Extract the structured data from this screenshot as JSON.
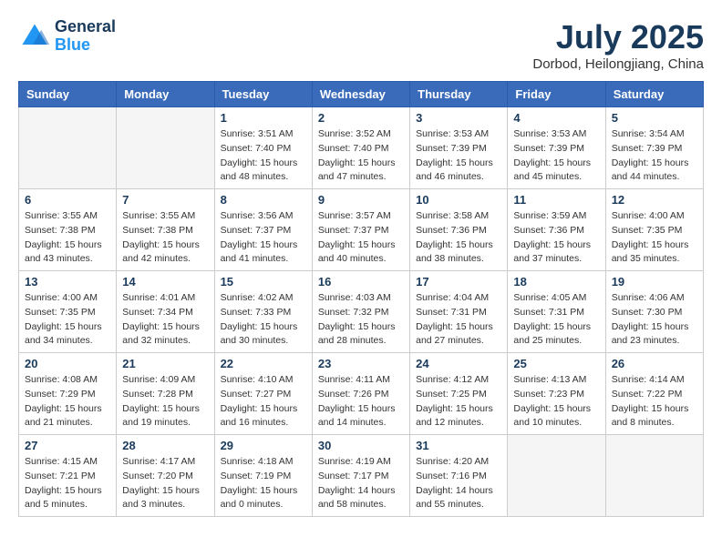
{
  "header": {
    "logo_line1": "General",
    "logo_line2": "Blue",
    "month_title": "July 2025",
    "location": "Dorbod, Heilongjiang, China"
  },
  "weekdays": [
    "Sunday",
    "Monday",
    "Tuesday",
    "Wednesday",
    "Thursday",
    "Friday",
    "Saturday"
  ],
  "weeks": [
    [
      {
        "day": "",
        "info": ""
      },
      {
        "day": "",
        "info": ""
      },
      {
        "day": "1",
        "info": "Sunrise: 3:51 AM\nSunset: 7:40 PM\nDaylight: 15 hours\nand 48 minutes."
      },
      {
        "day": "2",
        "info": "Sunrise: 3:52 AM\nSunset: 7:40 PM\nDaylight: 15 hours\nand 47 minutes."
      },
      {
        "day": "3",
        "info": "Sunrise: 3:53 AM\nSunset: 7:39 PM\nDaylight: 15 hours\nand 46 minutes."
      },
      {
        "day": "4",
        "info": "Sunrise: 3:53 AM\nSunset: 7:39 PM\nDaylight: 15 hours\nand 45 minutes."
      },
      {
        "day": "5",
        "info": "Sunrise: 3:54 AM\nSunset: 7:39 PM\nDaylight: 15 hours\nand 44 minutes."
      }
    ],
    [
      {
        "day": "6",
        "info": "Sunrise: 3:55 AM\nSunset: 7:38 PM\nDaylight: 15 hours\nand 43 minutes."
      },
      {
        "day": "7",
        "info": "Sunrise: 3:55 AM\nSunset: 7:38 PM\nDaylight: 15 hours\nand 42 minutes."
      },
      {
        "day": "8",
        "info": "Sunrise: 3:56 AM\nSunset: 7:37 PM\nDaylight: 15 hours\nand 41 minutes."
      },
      {
        "day": "9",
        "info": "Sunrise: 3:57 AM\nSunset: 7:37 PM\nDaylight: 15 hours\nand 40 minutes."
      },
      {
        "day": "10",
        "info": "Sunrise: 3:58 AM\nSunset: 7:36 PM\nDaylight: 15 hours\nand 38 minutes."
      },
      {
        "day": "11",
        "info": "Sunrise: 3:59 AM\nSunset: 7:36 PM\nDaylight: 15 hours\nand 37 minutes."
      },
      {
        "day": "12",
        "info": "Sunrise: 4:00 AM\nSunset: 7:35 PM\nDaylight: 15 hours\nand 35 minutes."
      }
    ],
    [
      {
        "day": "13",
        "info": "Sunrise: 4:00 AM\nSunset: 7:35 PM\nDaylight: 15 hours\nand 34 minutes."
      },
      {
        "day": "14",
        "info": "Sunrise: 4:01 AM\nSunset: 7:34 PM\nDaylight: 15 hours\nand 32 minutes."
      },
      {
        "day": "15",
        "info": "Sunrise: 4:02 AM\nSunset: 7:33 PM\nDaylight: 15 hours\nand 30 minutes."
      },
      {
        "day": "16",
        "info": "Sunrise: 4:03 AM\nSunset: 7:32 PM\nDaylight: 15 hours\nand 28 minutes."
      },
      {
        "day": "17",
        "info": "Sunrise: 4:04 AM\nSunset: 7:31 PM\nDaylight: 15 hours\nand 27 minutes."
      },
      {
        "day": "18",
        "info": "Sunrise: 4:05 AM\nSunset: 7:31 PM\nDaylight: 15 hours\nand 25 minutes."
      },
      {
        "day": "19",
        "info": "Sunrise: 4:06 AM\nSunset: 7:30 PM\nDaylight: 15 hours\nand 23 minutes."
      }
    ],
    [
      {
        "day": "20",
        "info": "Sunrise: 4:08 AM\nSunset: 7:29 PM\nDaylight: 15 hours\nand 21 minutes."
      },
      {
        "day": "21",
        "info": "Sunrise: 4:09 AM\nSunset: 7:28 PM\nDaylight: 15 hours\nand 19 minutes."
      },
      {
        "day": "22",
        "info": "Sunrise: 4:10 AM\nSunset: 7:27 PM\nDaylight: 15 hours\nand 16 minutes."
      },
      {
        "day": "23",
        "info": "Sunrise: 4:11 AM\nSunset: 7:26 PM\nDaylight: 15 hours\nand 14 minutes."
      },
      {
        "day": "24",
        "info": "Sunrise: 4:12 AM\nSunset: 7:25 PM\nDaylight: 15 hours\nand 12 minutes."
      },
      {
        "day": "25",
        "info": "Sunrise: 4:13 AM\nSunset: 7:23 PM\nDaylight: 15 hours\nand 10 minutes."
      },
      {
        "day": "26",
        "info": "Sunrise: 4:14 AM\nSunset: 7:22 PM\nDaylight: 15 hours\nand 8 minutes."
      }
    ],
    [
      {
        "day": "27",
        "info": "Sunrise: 4:15 AM\nSunset: 7:21 PM\nDaylight: 15 hours\nand 5 minutes."
      },
      {
        "day": "28",
        "info": "Sunrise: 4:17 AM\nSunset: 7:20 PM\nDaylight: 15 hours\nand 3 minutes."
      },
      {
        "day": "29",
        "info": "Sunrise: 4:18 AM\nSunset: 7:19 PM\nDaylight: 15 hours\nand 0 minutes."
      },
      {
        "day": "30",
        "info": "Sunrise: 4:19 AM\nSunset: 7:17 PM\nDaylight: 14 hours\nand 58 minutes."
      },
      {
        "day": "31",
        "info": "Sunrise: 4:20 AM\nSunset: 7:16 PM\nDaylight: 14 hours\nand 55 minutes."
      },
      {
        "day": "",
        "info": ""
      },
      {
        "day": "",
        "info": ""
      }
    ]
  ]
}
